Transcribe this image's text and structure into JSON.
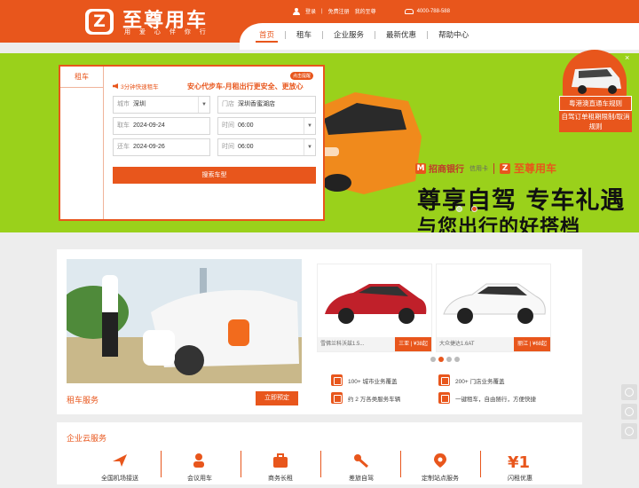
{
  "brand": {
    "name": "至尊用车",
    "slogan": "用 爱 心    伴 你 行"
  },
  "top_links": {
    "login": "登录",
    "divider": "|",
    "register": "免费注册",
    "my_account": "我的至尊",
    "phone": "4000-788-588"
  },
  "nav": {
    "items": [
      "首页",
      "租车",
      "企业服务",
      "最新优惠",
      "帮助中心"
    ],
    "active_index": 0
  },
  "booking": {
    "tab_label": "租车",
    "quick_title": "3分钟快速租车",
    "promo": "安心代步车-月租出行更安全、更放心",
    "badge": "点击提醒",
    "city": {
      "label": "城市",
      "value": "深圳"
    },
    "store": {
      "label": "门店",
      "value": "深圳香蜜湖店"
    },
    "pickup_date": {
      "label": "取车",
      "value": "2024-09-24"
    },
    "pickup_time": {
      "label": "时间",
      "value": "06:00"
    },
    "return_date": {
      "label": "还车",
      "value": "2024-09-26"
    },
    "return_time": {
      "label": "时间",
      "value": "06:00"
    },
    "search_button": "搜索车型"
  },
  "banner": {
    "bank_name": "招商银行",
    "bank_sub": "信用卡",
    "partner_brand": "至尊用车",
    "headline1": "尊享自驾 专车礼遇",
    "headline2": "与您出行的好搭档",
    "slide_count": 2,
    "active_slide": 1
  },
  "float_ad": {
    "title": "粤港澳直通车规则",
    "line2": "自驾订单租期限制/取消规则",
    "close": "×"
  },
  "rental": {
    "section_title": "租车服务",
    "book_button": "立即预定",
    "cars": [
      {
        "name": "雪佛兰科沃兹1.5...",
        "city": "三亚",
        "price": "¥38起",
        "color": "#c0202a"
      },
      {
        "name": "大众捷达1.6AT",
        "city": "丽江",
        "price": "¥68起",
        "color": "#f4f4f4"
      }
    ],
    "active_dot": 1,
    "dot_count": 4,
    "features": [
      "100+ 城市业务覆盖",
      "200+ 门店业务覆盖",
      "约 2 万各类服务车辆",
      "一键租车，自由随行，方便快捷"
    ]
  },
  "enterprise": {
    "section_title": "企业云服务",
    "services": [
      "全国机场接送",
      "会议用车",
      "商务长租",
      "差旅自驾",
      "定制站点服务",
      "闪租优惠"
    ]
  },
  "colors": {
    "brand": "#e8561c",
    "banner_bg": "#9ad11b"
  }
}
